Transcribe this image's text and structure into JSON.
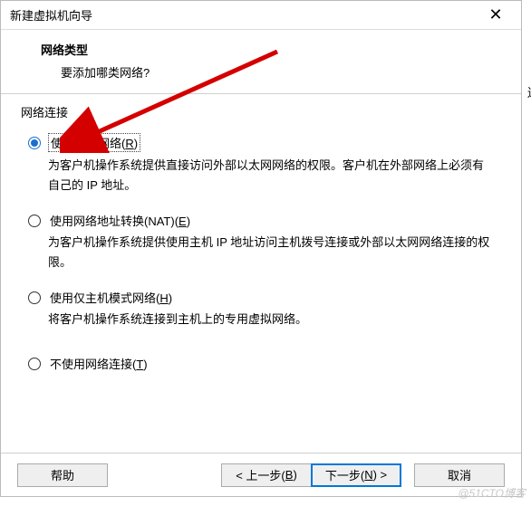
{
  "window": {
    "title": "新建虚拟机向导",
    "close_glyph": "✕"
  },
  "header": {
    "title": "网络类型",
    "subtitle": "要添加哪类网络?"
  },
  "group": {
    "label": "网络连接"
  },
  "options": {
    "bridged": {
      "label_pre": "使用桥接网络(",
      "label_key": "R",
      "label_post": ")",
      "desc": "为客户机操作系统提供直接访问外部以太网网络的权限。客户机在外部网络上必须有自己的 IP 地址。"
    },
    "nat": {
      "label_pre": "使用网络地址转换(NAT)(",
      "label_key": "E",
      "label_post": ")",
      "desc": "为客户机操作系统提供使用主机 IP 地址访问主机拨号连接或外部以太网网络连接的权限。"
    },
    "hostonly": {
      "label_pre": "使用仅主机模式网络(",
      "label_key": "H",
      "label_post": ")",
      "desc": "将客户机操作系统连接到主机上的专用虚拟网络。"
    },
    "none": {
      "label_pre": "不使用网络连接(",
      "label_key": "T",
      "label_post": ")"
    }
  },
  "buttons": {
    "help": "帮助",
    "back_pre": "< 上一步(",
    "back_key": "B",
    "back_post": ")",
    "next_pre": "下一步(",
    "next_key": "N",
    "next_post": ") >",
    "cancel": "取消"
  },
  "watermark": "@51CTO博客",
  "side_char": "送"
}
